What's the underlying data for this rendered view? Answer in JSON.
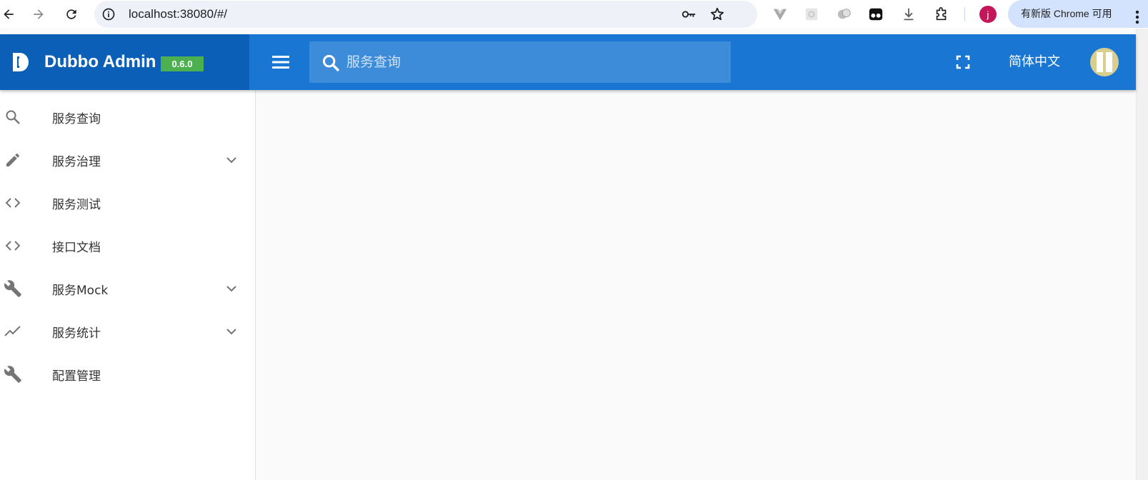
{
  "browser": {
    "url": "localhost:38080/#/",
    "update_label": "有新版 Chrome 可用",
    "profile_initial": "j"
  },
  "app": {
    "title": "Dubbo Admin",
    "version": "0.6.0",
    "search_placeholder": "服务查询",
    "language": "简体中文",
    "colors": {
      "toolbar": "#1976d2",
      "brand": "#0b5fb6",
      "badge": "#4caf50",
      "background": "#fafafa"
    }
  },
  "sidebar": {
    "items": [
      {
        "label": "服务查询",
        "icon": "search-icon",
        "expandable": false
      },
      {
        "label": "服务治理",
        "icon": "pencil-icon",
        "expandable": true
      },
      {
        "label": "服务测试",
        "icon": "code-icon",
        "expandable": false
      },
      {
        "label": "接口文档",
        "icon": "code-icon",
        "expandable": false
      },
      {
        "label": "服务Mock",
        "icon": "wrench-icon",
        "expandable": true
      },
      {
        "label": "服务统计",
        "icon": "trending-icon",
        "expandable": true
      },
      {
        "label": "配置管理",
        "icon": "wrench-icon",
        "expandable": false
      }
    ]
  }
}
